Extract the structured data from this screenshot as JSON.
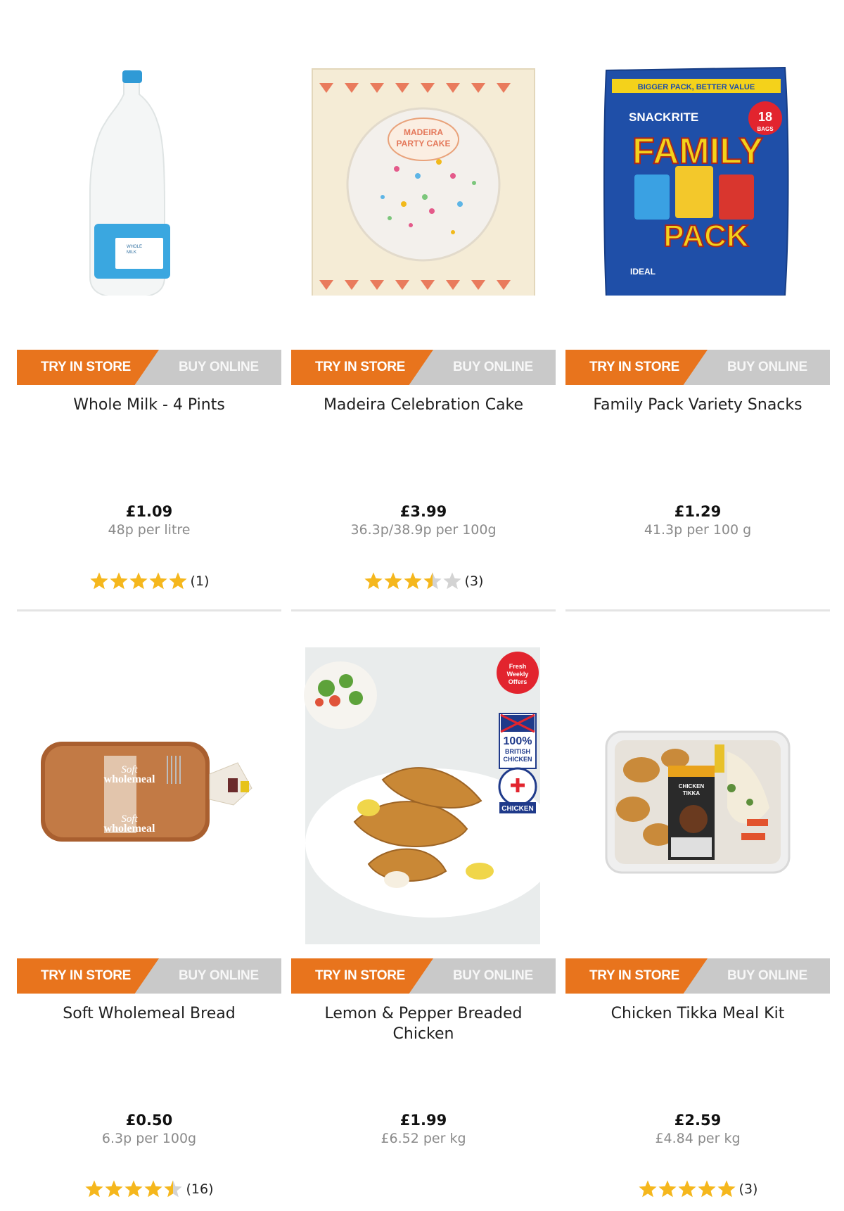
{
  "products": [
    {
      "name": "Whole Milk - 4 Pints",
      "price": "£1.09",
      "unit_price": "48p per litre",
      "rating": 5,
      "review_count": "(1)",
      "try_label": "TRY IN STORE",
      "buy_label": "BUY ONLINE",
      "image_icon": "milk-bottle-icon",
      "image_text": [
        "WHOLE",
        "MILK"
      ]
    },
    {
      "name": "Madeira Celebration Cake",
      "price": "£3.99",
      "unit_price": "36.3p/38.9p per 100g",
      "rating": 3.5,
      "review_count": "(3)",
      "try_label": "TRY IN STORE",
      "buy_label": "BUY ONLINE",
      "image_icon": "party-cake-box-icon",
      "image_text": [
        "MADEIRA",
        "PARTY CAKE"
      ]
    },
    {
      "name": "Family Pack Variety Snacks",
      "price": "£1.29",
      "unit_price": "41.3p per 100 g",
      "rating": null,
      "review_count": "",
      "try_label": "TRY IN STORE",
      "buy_label": "BUY ONLINE",
      "image_icon": "snack-bag-icon",
      "image_text": [
        "BIGGER PACK, BETTER VALUE",
        "SNACKRITE",
        "FAMILY",
        "PACK",
        "18",
        "BAGS",
        "IDEAL"
      ]
    },
    {
      "name": "Soft Wholemeal Bread",
      "price": "£0.50",
      "unit_price": "6.3p per 100g",
      "rating": 4.5,
      "review_count": "(16)",
      "try_label": "TRY IN STORE",
      "buy_label": "BUY ONLINE",
      "image_icon": "bread-loaf-icon",
      "image_text": [
        "Soft",
        "wholemeal"
      ]
    },
    {
      "name": "Lemon & Pepper Breaded Chicken",
      "price": "£1.99",
      "unit_price": "£6.52 per kg",
      "rating": null,
      "review_count": "",
      "try_label": "TRY IN STORE",
      "buy_label": "BUY ONLINE",
      "image_icon": "breaded-chicken-plate-icon",
      "image_text": [
        "Fresh",
        "Weekly",
        "Offers",
        "100%",
        "BRITISH",
        "CHICKEN",
        "CHICKEN"
      ]
    },
    {
      "name": "Chicken Tikka Meal Kit",
      "price": "£2.59",
      "unit_price": "£4.84 per kg",
      "rating": 5,
      "review_count": "(3)",
      "try_label": "TRY IN STORE",
      "buy_label": "BUY ONLINE",
      "image_icon": "meal-kit-tray-icon",
      "image_text": [
        "CHICKEN",
        "TIKKA"
      ]
    }
  ],
  "colors": {
    "try_in_store": "#e8741d",
    "buy_online": "#c9c9c9",
    "star": "#f5b71d",
    "star_empty": "#d3d3d3"
  }
}
